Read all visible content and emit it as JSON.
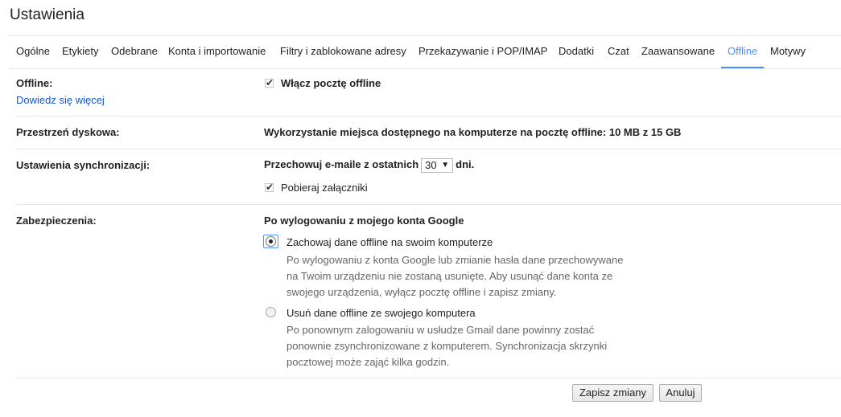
{
  "header": {
    "title": "Ustawienia"
  },
  "tabs": [
    {
      "label": "Ogólne"
    },
    {
      "label": "Etykiety"
    },
    {
      "label": "Odebrane"
    },
    {
      "label": "Konta i importowanie"
    },
    {
      "label": "Filtry i zablokowane adresy"
    },
    {
      "label": "Przekazywanie i POP/IMAP"
    },
    {
      "label": "Dodatki"
    },
    {
      "label": "Czat"
    },
    {
      "label": "Zaawansowane"
    },
    {
      "label": "Offline",
      "active": true
    },
    {
      "label": "Motywy"
    }
  ],
  "offline": {
    "label": "Offline:",
    "learn_more": "Dowiedz się więcej",
    "enable_label": "Włącz pocztę offline",
    "enable_checked": true
  },
  "storage": {
    "label": "Przestrzeń dyskowa:",
    "value": "Wykorzystanie miejsca dostępnego na komputerze na pocztę offline: 10 MB z 15 GB"
  },
  "sync": {
    "label": "Ustawienia synchronizacji:",
    "keep_prefix": "Przechowuj e-maile z ostatnich",
    "days_value": "30",
    "days_suffix": "dni.",
    "attachments_label": "Pobieraj załączniki",
    "attachments_checked": true
  },
  "security": {
    "label": "Zabezpieczenia:",
    "heading": "Po wylogowaniu z mojego konta Google",
    "options": [
      {
        "title": "Zachowaj dane offline na swoim komputerze",
        "lines": [
          "Po wylogowaniu z konta Google lub zmianie hasła dane przechowywane",
          "na Twoim urządzeniu nie zostaną usunięte. Aby usunąć dane konta ze",
          "swojego urządzenia, wyłącz pocztę offline i zapisz zmiany."
        ],
        "selected": true
      },
      {
        "title": "Usuń dane offline ze swojego komputera",
        "lines": [
          "Po ponownym zalogowaniu w usłudze Gmail dane powinny zostać",
          "ponownie zsynchronizowane z komputerem. Synchronizacja skrzynki",
          "pocztowej może zająć kilka godzin."
        ],
        "selected": false
      }
    ]
  },
  "actions": {
    "save_label": "Zapisz zmiany",
    "cancel_label": "Anuluj"
  },
  "colors": {
    "accent": "#4d90fe",
    "link": "#1155cc"
  }
}
